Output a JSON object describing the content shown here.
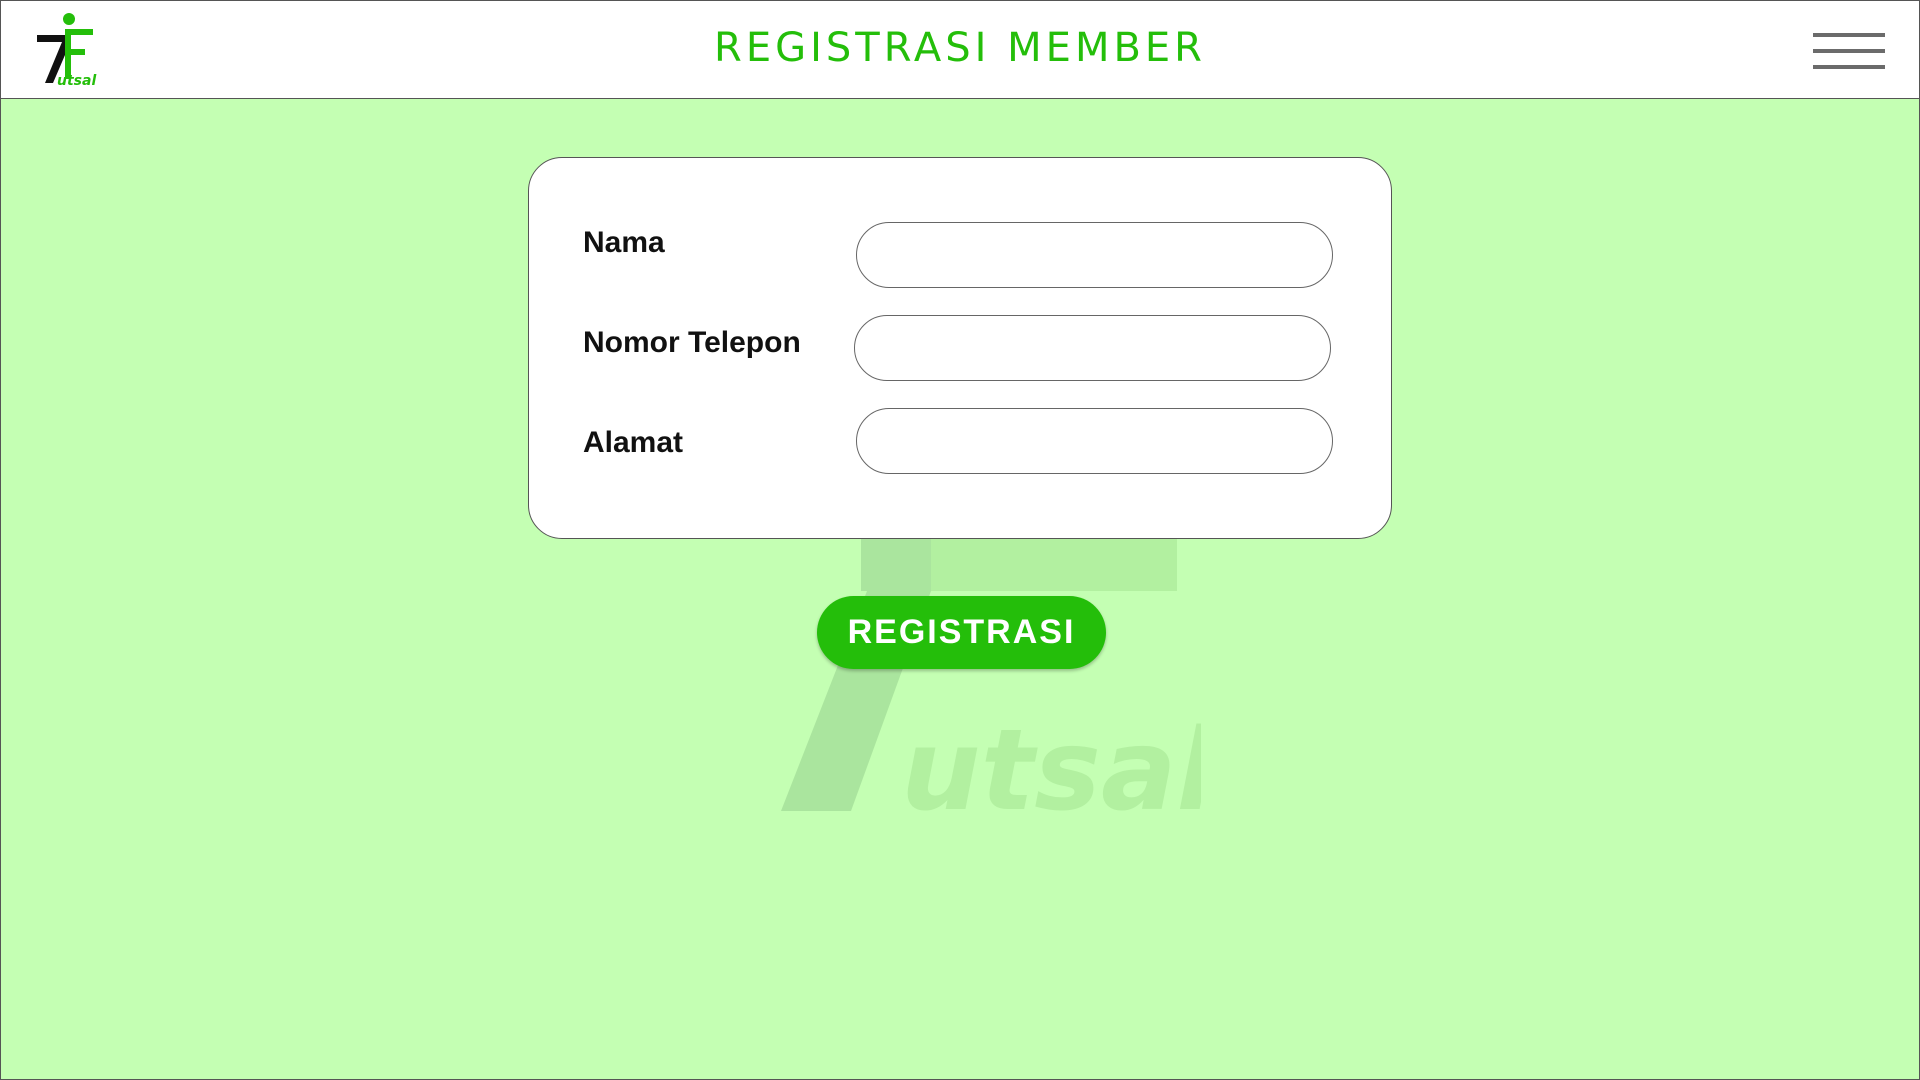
{
  "header": {
    "logo_text": "utsal",
    "title": "REGISTRASI MEMBER",
    "menu_icon": "hamburger-menu-icon"
  },
  "watermark": {
    "text": "utsal"
  },
  "form": {
    "fields": [
      {
        "label": "Nama",
        "value": "",
        "placeholder": ""
      },
      {
        "label": "Nomor Telepon",
        "value": "",
        "placeholder": ""
      },
      {
        "label": "Alamat",
        "value": "",
        "placeholder": ""
      }
    ],
    "submit_label": "REGISTRASI"
  },
  "colors": {
    "brand_green": "#24be0a",
    "background": "#c4ffb3",
    "header_bg": "#ffffff",
    "menu_bar": "#6b6b6b"
  }
}
